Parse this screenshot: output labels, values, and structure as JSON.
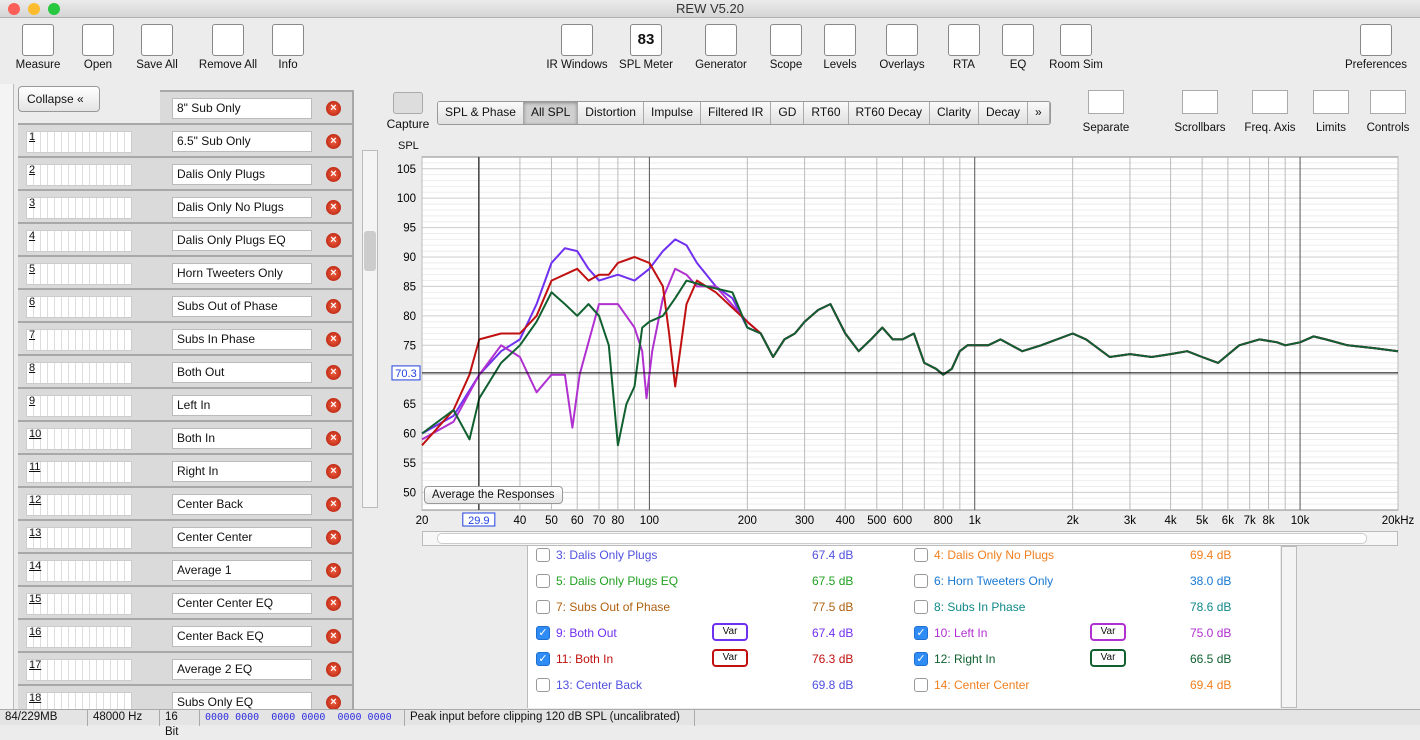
{
  "window": {
    "title": "REW V5.20"
  },
  "toolbar": {
    "left": [
      {
        "label": "Measure",
        "icon": "measure-icon"
      },
      {
        "label": "Open",
        "icon": "folder-icon"
      },
      {
        "label": "Save All",
        "icon": "save-icon"
      },
      {
        "label": "Remove All",
        "icon": "remove-all-icon"
      },
      {
        "label": "Info",
        "icon": "info-icon"
      }
    ],
    "center": [
      {
        "label": "IR Windows",
        "icon": "ir-windows-icon"
      },
      {
        "label": "SPL Meter",
        "icon": "spl-meter-icon",
        "badge": "83"
      },
      {
        "label": "Generator",
        "icon": "generator-icon"
      },
      {
        "label": "Scope",
        "icon": "scope-icon"
      },
      {
        "label": "Levels",
        "icon": "levels-icon"
      },
      {
        "label": "Overlays",
        "icon": "overlays-icon"
      },
      {
        "label": "RTA",
        "icon": "rta-icon"
      },
      {
        "label": "EQ",
        "icon": "eq-icon"
      },
      {
        "label": "Room Sim",
        "icon": "room-sim-icon"
      }
    ],
    "right": {
      "label": "Preferences",
      "icon": "wrench-icon"
    }
  },
  "left_panel": {
    "collapse_label": "Collapse",
    "measurements": [
      {
        "num": "",
        "name": "8\" Sub Only",
        "color": "#c01010"
      },
      {
        "num": "1",
        "name": "6.5\" Sub Only",
        "color": "#c01010"
      },
      {
        "num": "2",
        "name": "Dalis Only Plugs",
        "color": "#106030"
      },
      {
        "num": "3",
        "name": "Dalis Only No Plugs",
        "color": "#3030d0"
      },
      {
        "num": "4",
        "name": "Dalis Only Plugs EQ",
        "color": "#e07000"
      },
      {
        "num": "5",
        "name": "Horn Tweeters Only",
        "color": "#10a010"
      },
      {
        "num": "6",
        "name": "Subs Out of Phase",
        "color": "#1060c0"
      },
      {
        "num": "7",
        "name": "Subs In Phase",
        "color": "#b06010"
      },
      {
        "num": "8",
        "name": "Both Out",
        "color": "#108888"
      },
      {
        "num": "9",
        "name": "Left In",
        "color": "#7030f0"
      },
      {
        "num": "10",
        "name": "Both In",
        "color": "#b030d0"
      },
      {
        "num": "11",
        "name": "Right In",
        "color": "#c01010"
      },
      {
        "num": "12",
        "name": "Center Back",
        "color": "#106030"
      },
      {
        "num": "13",
        "name": "Center Center",
        "color": "#3030d0"
      },
      {
        "num": "14",
        "name": "Average 1",
        "color": "#e07000"
      },
      {
        "num": "15",
        "name": "Center Center EQ",
        "color": "#10a010"
      },
      {
        "num": "16",
        "name": "Center Back EQ",
        "color": "#1060c0"
      },
      {
        "num": "17",
        "name": "Average 2 EQ",
        "color": "#b06010"
      },
      {
        "num": "18",
        "name": "Subs Only EQ",
        "color": "#108888"
      }
    ]
  },
  "capture_label": "Capture",
  "tabs": [
    {
      "label": "SPL & Phase"
    },
    {
      "label": "All SPL",
      "selected": true
    },
    {
      "label": "Distortion"
    },
    {
      "label": "Impulse"
    },
    {
      "label": "Filtered IR"
    },
    {
      "label": "GD"
    },
    {
      "label": "RT60"
    },
    {
      "label": "RT60 Decay"
    },
    {
      "label": "Clarity"
    },
    {
      "label": "Decay"
    },
    {
      "label": "»"
    }
  ],
  "graph_tools": [
    {
      "label": "Separate",
      "icon": "separate-icon"
    },
    {
      "label": "Scrollbars",
      "icon": "scrollbars-icon"
    },
    {
      "label": "Freq. Axis",
      "icon": "freq-axis-icon"
    },
    {
      "label": "Limits",
      "icon": "limits-icon"
    },
    {
      "label": "Controls",
      "icon": "gear-icon"
    }
  ],
  "average_button": "Average the Responses",
  "cursor": {
    "x_readout": "29.9",
    "y_readout": "70.3"
  },
  "chart_data": {
    "type": "line",
    "ylabel": "SPL",
    "xscale": "log",
    "xlim": [
      20,
      20000
    ],
    "ylim": [
      47,
      107
    ],
    "grid": true,
    "yticks": [
      50,
      55,
      60,
      65,
      70,
      75,
      80,
      85,
      90,
      95,
      100,
      105
    ],
    "xticks": [
      {
        "v": 20,
        "l": "20"
      },
      {
        "v": 40,
        "l": "40"
      },
      {
        "v": 50,
        "l": "50"
      },
      {
        "v": 60,
        "l": "60"
      },
      {
        "v": 70,
        "l": "70"
      },
      {
        "v": 80,
        "l": "80"
      },
      {
        "v": 100,
        "l": "100"
      },
      {
        "v": 200,
        "l": "200"
      },
      {
        "v": 300,
        "l": "300"
      },
      {
        "v": 400,
        "l": "400"
      },
      {
        "v": 500,
        "l": "500"
      },
      {
        "v": 600,
        "l": "600"
      },
      {
        "v": 800,
        "l": "800"
      },
      {
        "v": 1000,
        "l": "1k"
      },
      {
        "v": 2000,
        "l": "2k"
      },
      {
        "v": 3000,
        "l": "3k"
      },
      {
        "v": 4000,
        "l": "4k"
      },
      {
        "v": 5000,
        "l": "5k"
      },
      {
        "v": 6000,
        "l": "6k"
      },
      {
        "v": 7000,
        "l": "7k"
      },
      {
        "v": 8000,
        "l": "8k"
      },
      {
        "v": 10000,
        "l": "10k"
      },
      {
        "v": 20000,
        "l": "20kHz"
      }
    ],
    "common_tail": [
      [
        220,
        77
      ],
      [
        240,
        73
      ],
      [
        260,
        76
      ],
      [
        280,
        77
      ],
      [
        300,
        79
      ],
      [
        330,
        81
      ],
      [
        360,
        82
      ],
      [
        400,
        77
      ],
      [
        440,
        74
      ],
      [
        480,
        76
      ],
      [
        520,
        78
      ],
      [
        560,
        76
      ],
      [
        600,
        76
      ],
      [
        650,
        77
      ],
      [
        700,
        72
      ],
      [
        760,
        71
      ],
      [
        800,
        70
      ],
      [
        850,
        71
      ],
      [
        900,
        74
      ],
      [
        950,
        75
      ],
      [
        1000,
        75
      ],
      [
        1100,
        75
      ],
      [
        1200,
        76
      ],
      [
        1400,
        74
      ],
      [
        1600,
        75
      ],
      [
        2000,
        77
      ],
      [
        2200,
        76
      ],
      [
        2600,
        73
      ],
      [
        3000,
        73.5
      ],
      [
        3500,
        73
      ],
      [
        4000,
        73.5
      ],
      [
        4500,
        74
      ],
      [
        5000,
        73
      ],
      [
        5600,
        72
      ],
      [
        6500,
        75
      ],
      [
        7500,
        76
      ],
      [
        8500,
        75.5
      ],
      [
        9000,
        75
      ],
      [
        10000,
        75.5
      ],
      [
        11000,
        76.5
      ],
      [
        12000,
        76
      ],
      [
        14000,
        75
      ],
      [
        17000,
        74.5
      ],
      [
        20000,
        74
      ]
    ],
    "series": [
      {
        "name": "9: Both Out",
        "color": "#7030f0",
        "points": [
          [
            20,
            60
          ],
          [
            25,
            63
          ],
          [
            30,
            70
          ],
          [
            35,
            74
          ],
          [
            40,
            76
          ],
          [
            45,
            82
          ],
          [
            50,
            89
          ],
          [
            55,
            91.5
          ],
          [
            60,
            91
          ],
          [
            65,
            88
          ],
          [
            70,
            86
          ],
          [
            80,
            87
          ],
          [
            90,
            86
          ],
          [
            100,
            88
          ],
          [
            110,
            91
          ],
          [
            120,
            93
          ],
          [
            130,
            92
          ],
          [
            140,
            89
          ],
          [
            160,
            85
          ],
          [
            180,
            83
          ],
          [
            200,
            78
          ]
        ]
      },
      {
        "name": "10: Left In",
        "color": "#b030d0",
        "points": [
          [
            20,
            59
          ],
          [
            25,
            62
          ],
          [
            30,
            70
          ],
          [
            35,
            75
          ],
          [
            40,
            73
          ],
          [
            45,
            67
          ],
          [
            50,
            70
          ],
          [
            55,
            70
          ],
          [
            58,
            61
          ],
          [
            61,
            70
          ],
          [
            70,
            82
          ],
          [
            80,
            82
          ],
          [
            90,
            78
          ],
          [
            95,
            74
          ],
          [
            98,
            66
          ],
          [
            102,
            74
          ],
          [
            110,
            83
          ],
          [
            120,
            88
          ],
          [
            130,
            87
          ],
          [
            140,
            85
          ],
          [
            160,
            85
          ],
          [
            200,
            79
          ]
        ]
      },
      {
        "name": "11: Both In",
        "color": "#c01010",
        "points": [
          [
            20,
            58
          ],
          [
            25,
            64
          ],
          [
            28,
            70
          ],
          [
            30,
            76
          ],
          [
            35,
            77
          ],
          [
            40,
            77
          ],
          [
            45,
            80
          ],
          [
            50,
            86
          ],
          [
            60,
            88
          ],
          [
            65,
            86
          ],
          [
            70,
            87
          ],
          [
            75,
            87
          ],
          [
            80,
            89
          ],
          [
            90,
            90
          ],
          [
            100,
            89
          ],
          [
            110,
            85
          ],
          [
            115,
            77
          ],
          [
            120,
            68
          ],
          [
            125,
            75
          ],
          [
            130,
            82
          ],
          [
            140,
            86
          ],
          [
            160,
            84
          ],
          [
            200,
            79
          ]
        ]
      },
      {
        "name": "12: Right In",
        "color": "#106030",
        "points": [
          [
            20,
            60
          ],
          [
            25,
            64
          ],
          [
            28,
            59
          ],
          [
            30,
            66
          ],
          [
            35,
            72
          ],
          [
            40,
            75
          ],
          [
            45,
            79
          ],
          [
            50,
            84
          ],
          [
            55,
            82
          ],
          [
            60,
            80
          ],
          [
            65,
            82
          ],
          [
            70,
            80
          ],
          [
            75,
            75
          ],
          [
            80,
            58
          ],
          [
            85,
            65
          ],
          [
            90,
            68
          ],
          [
            95,
            78
          ],
          [
            100,
            79
          ],
          [
            110,
            80
          ],
          [
            120,
            83
          ],
          [
            130,
            86
          ],
          [
            150,
            85
          ],
          [
            180,
            84
          ],
          [
            200,
            78
          ]
        ]
      }
    ]
  },
  "legend": [
    {
      "label": "3: Dalis Only Plugs",
      "value": "67.4 dB",
      "color": "#5050e0",
      "checked": false
    },
    {
      "label": "4: Dalis Only No Plugs",
      "value": "69.4 dB",
      "color": "#f08020",
      "checked": false
    },
    {
      "label": "5: Dalis Only Plugs EQ",
      "value": "67.5 dB",
      "color": "#20a020",
      "checked": false
    },
    {
      "label": "6: Horn Tweeters Only",
      "value": "38.0 dB",
      "color": "#1878d0",
      "checked": false
    },
    {
      "label": "7: Subs Out of Phase",
      "value": "77.5 dB",
      "color": "#b06010",
      "checked": false
    },
    {
      "label": "8: Subs In Phase",
      "value": "78.6 dB",
      "color": "#108888",
      "checked": false
    },
    {
      "label": "9: Both Out",
      "value": "67.4 dB",
      "color": "#7030f0",
      "checked": true,
      "var": "Var"
    },
    {
      "label": "10: Left In",
      "value": "75.0 dB",
      "color": "#b030d0",
      "checked": true,
      "var": "Var"
    },
    {
      "label": "11: Both In",
      "value": "76.3 dB",
      "color": "#c01010",
      "checked": true,
      "var": "Var"
    },
    {
      "label": "12: Right In",
      "value": "66.5 dB",
      "color": "#106030",
      "checked": true,
      "var": "Var"
    },
    {
      "label": "13: Center Back",
      "value": "69.8 dB",
      "color": "#5050e0",
      "checked": false
    },
    {
      "label": "14: Center Center",
      "value": "69.4 dB",
      "color": "#f08020",
      "checked": false
    }
  ],
  "status": {
    "memory": "84/229MB",
    "rate": "48000 Hz",
    "bits": "16 Bit",
    "levels": "0000 0000  0000 0000  0000 0000",
    "message": "Peak input before clipping 120 dB SPL (uncalibrated)"
  }
}
